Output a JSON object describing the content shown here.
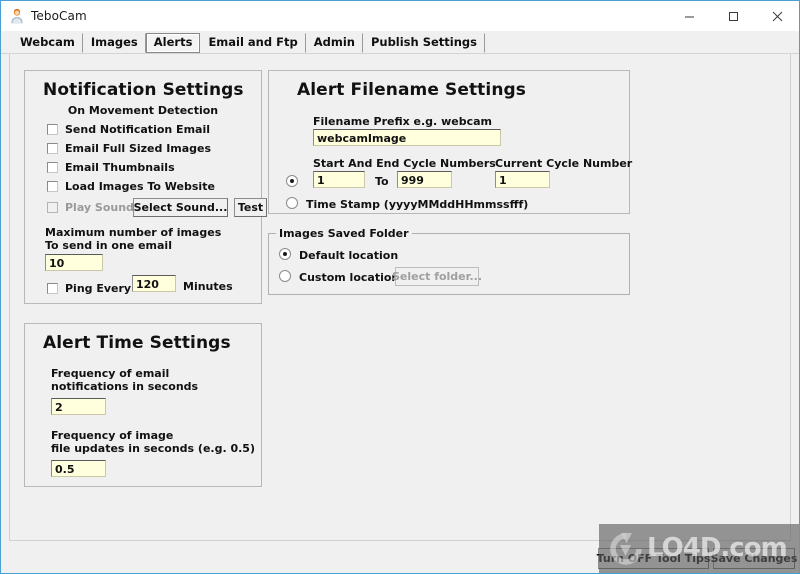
{
  "window": {
    "title": "TeboCam",
    "icon": "app-user-icon",
    "controls": {
      "minimize": "minimize-icon",
      "maximize": "maximize-icon",
      "close": "close-icon"
    }
  },
  "tabs": [
    {
      "label": "Webcam",
      "active": false
    },
    {
      "label": "Images",
      "active": false
    },
    {
      "label": "Alerts",
      "active": true
    },
    {
      "label": "Email and Ftp",
      "active": false
    },
    {
      "label": "Admin",
      "active": false
    },
    {
      "label": "Publish Settings",
      "active": false
    }
  ],
  "notification_settings": {
    "title": "Notification Settings",
    "subtitle": "On Movement Detection",
    "checkboxes": [
      {
        "label": "Send Notification Email",
        "checked": false,
        "enabled": true
      },
      {
        "label": "Email Full Sized Images",
        "checked": false,
        "enabled": true
      },
      {
        "label": "Email Thumbnails",
        "checked": false,
        "enabled": true
      },
      {
        "label": "Load Images To Website",
        "checked": false,
        "enabled": true
      },
      {
        "label": "Play Sound",
        "checked": false,
        "enabled": false
      }
    ],
    "select_sound_button": "Select Sound...",
    "test_button": "Test",
    "max_images_label_line1": "Maximum number of images",
    "max_images_label_line2": "To send in one email",
    "max_images_value": "10",
    "ping_label": "Ping Every",
    "ping_checked": false,
    "ping_value": "120",
    "ping_units": "Minutes"
  },
  "alert_time_settings": {
    "title": "Alert Time Settings",
    "email_freq_label_line1": "Frequency of email",
    "email_freq_label_line2": "notifications in seconds",
    "email_freq_value": "2",
    "image_freq_label_line1": "Frequency of image",
    "image_freq_label_line2": "file updates in seconds (e.g. 0.5)",
    "image_freq_value": "0.5"
  },
  "alert_filename_settings": {
    "title": "Alert Filename Settings",
    "prefix_label": "Filename Prefix e.g. webcam",
    "prefix_value": "webcamImage",
    "cycle_numbers_label": "Start And End Cycle Numbers",
    "current_cycle_label": "Current Cycle Number",
    "cycle_start_value": "1",
    "to_label": "To",
    "cycle_end_value": "999",
    "current_cycle_value": "1",
    "mode_cycle_selected": true,
    "timestamp_label": "Time Stamp (yyyyMMddHHmmssfff)",
    "mode_timestamp_selected": false
  },
  "images_saved_folder": {
    "legend": "Images Saved Folder",
    "default_label": "Default location",
    "default_selected": true,
    "custom_label": "Custom location",
    "custom_selected": false,
    "select_folder_button": "Select folder...",
    "select_folder_enabled": false
  },
  "bottom_bar": {
    "tooltips_button": "Turn OFF Tool Tips",
    "save_button": "Save Changes"
  },
  "watermark": {
    "text": "LO4D.com",
    "logo": "refresh-circle-logo"
  }
}
